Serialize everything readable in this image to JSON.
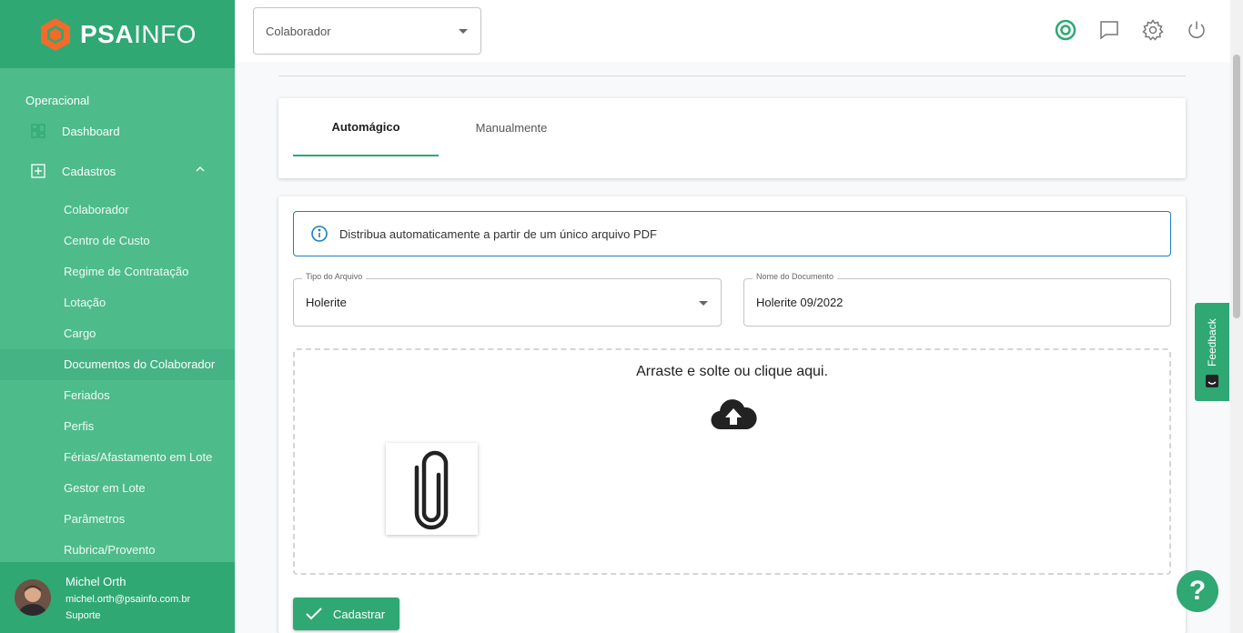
{
  "brand": {
    "name_bold": "PSA",
    "name_light": "INFO"
  },
  "header": {
    "select_value": "Colaborador",
    "icons": [
      "target-icon",
      "chat-icon",
      "gear-icon",
      "power-icon"
    ]
  },
  "sidebar": {
    "section": "Operacional",
    "items": [
      {
        "label": "Dashboard",
        "icon": "grid-icon"
      },
      {
        "label": "Cadastros",
        "icon": "plus-square-icon"
      }
    ],
    "subitems": [
      "Colaborador",
      "Centro de Custo",
      "Regime de Contratação",
      "Lotação",
      "Cargo",
      "Documentos do Colaborador",
      "Feriados",
      "Perfis",
      "Férias/Afastamento em Lote",
      "Gestor em Lote",
      "Parâmetros",
      "Rubrica/Provento"
    ],
    "active_subitem": "Documentos do Colaborador"
  },
  "user": {
    "name": "Michel Orth",
    "email": "michel.orth@psainfo.com.br",
    "role": "Suporte"
  },
  "tabs": [
    {
      "label": "Automágico",
      "active": true
    },
    {
      "label": "Manualmente",
      "active": false
    }
  ],
  "form": {
    "info": "Distribua automaticamente a partir de um único arquivo PDF",
    "tipo_label": "Tipo do Arquivo",
    "tipo_value": "Holerite",
    "nome_label": "Nome do Documento",
    "nome_value": "Holerite 09/2022",
    "dropzone_text": "Arraste e solte ou clique aqui.",
    "submit_label": "Cadastrar"
  },
  "widgets": {
    "feedback_label": "Feedback",
    "help_label": "?"
  },
  "colors": {
    "primary": "#2fa874",
    "sidebar": "#4dbb8a",
    "info_border": "#1e7bc0"
  }
}
